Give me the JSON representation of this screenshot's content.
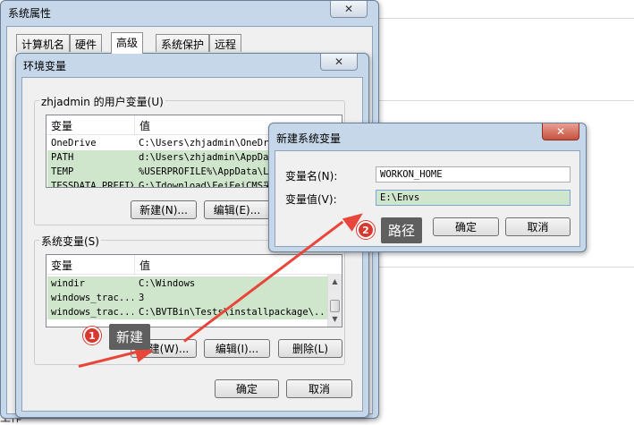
{
  "background": {
    "bottom_text": "工作"
  },
  "system_properties": {
    "title": "系统属性",
    "close_glyph": "✕",
    "tabs": [
      "计算机名",
      "硬件",
      "高级",
      "系统保护",
      "远程"
    ],
    "active_tab": "高级"
  },
  "env_vars": {
    "title": "环境变量",
    "close_glyph": "✕",
    "user_group_label": "zhjadmin 的用户变量(U)",
    "system_group_label": "系统变量(S)",
    "col_var": "变量",
    "col_val": "值",
    "user_vars": [
      {
        "name": "OneDrive",
        "value": "C:\\Users\\zhjadmin\\OneDrive"
      },
      {
        "name": "PATH",
        "value": "d:\\Users\\zhjadmin\\AppData"
      },
      {
        "name": "TEMP",
        "value": "%USERPROFILE%\\AppData\\Loc"
      },
      {
        "name": "TESSDATA_PREFIX",
        "value": "G:\\Tdownload\\FeiFeiCMS采"
      }
    ],
    "system_vars": [
      {
        "name": "windir",
        "value": "C:\\Windows"
      },
      {
        "name": "windows_trac...",
        "value": "3"
      },
      {
        "name": "windows_trac...",
        "value": "C:\\BVTBin\\Tests\\installpackage\\..."
      }
    ],
    "user_buttons": {
      "new": "新建(N)...",
      "edit": "编辑(E)..."
    },
    "system_buttons": {
      "new": "新建(W)...",
      "edit": "编辑(I)...",
      "delete": "删除(L)"
    },
    "ok": "确定",
    "cancel": "取消"
  },
  "new_sys_var": {
    "title": "新建系统变量",
    "close_glyph": "✕",
    "name_label": "变量名(N):",
    "value_label": "变量值(V):",
    "name_value": "WORKON_HOME",
    "value_value": "E:\\Envs",
    "ok": "确定",
    "cancel": "取消"
  },
  "annotations": [
    {
      "number": "1",
      "label": "新建"
    },
    {
      "number": "2",
      "label": "路径"
    }
  ],
  "colors": {
    "annotation_red": "#d8382e",
    "selection_green": "#cfe5cc",
    "label_gray": "#5f5f5f"
  }
}
